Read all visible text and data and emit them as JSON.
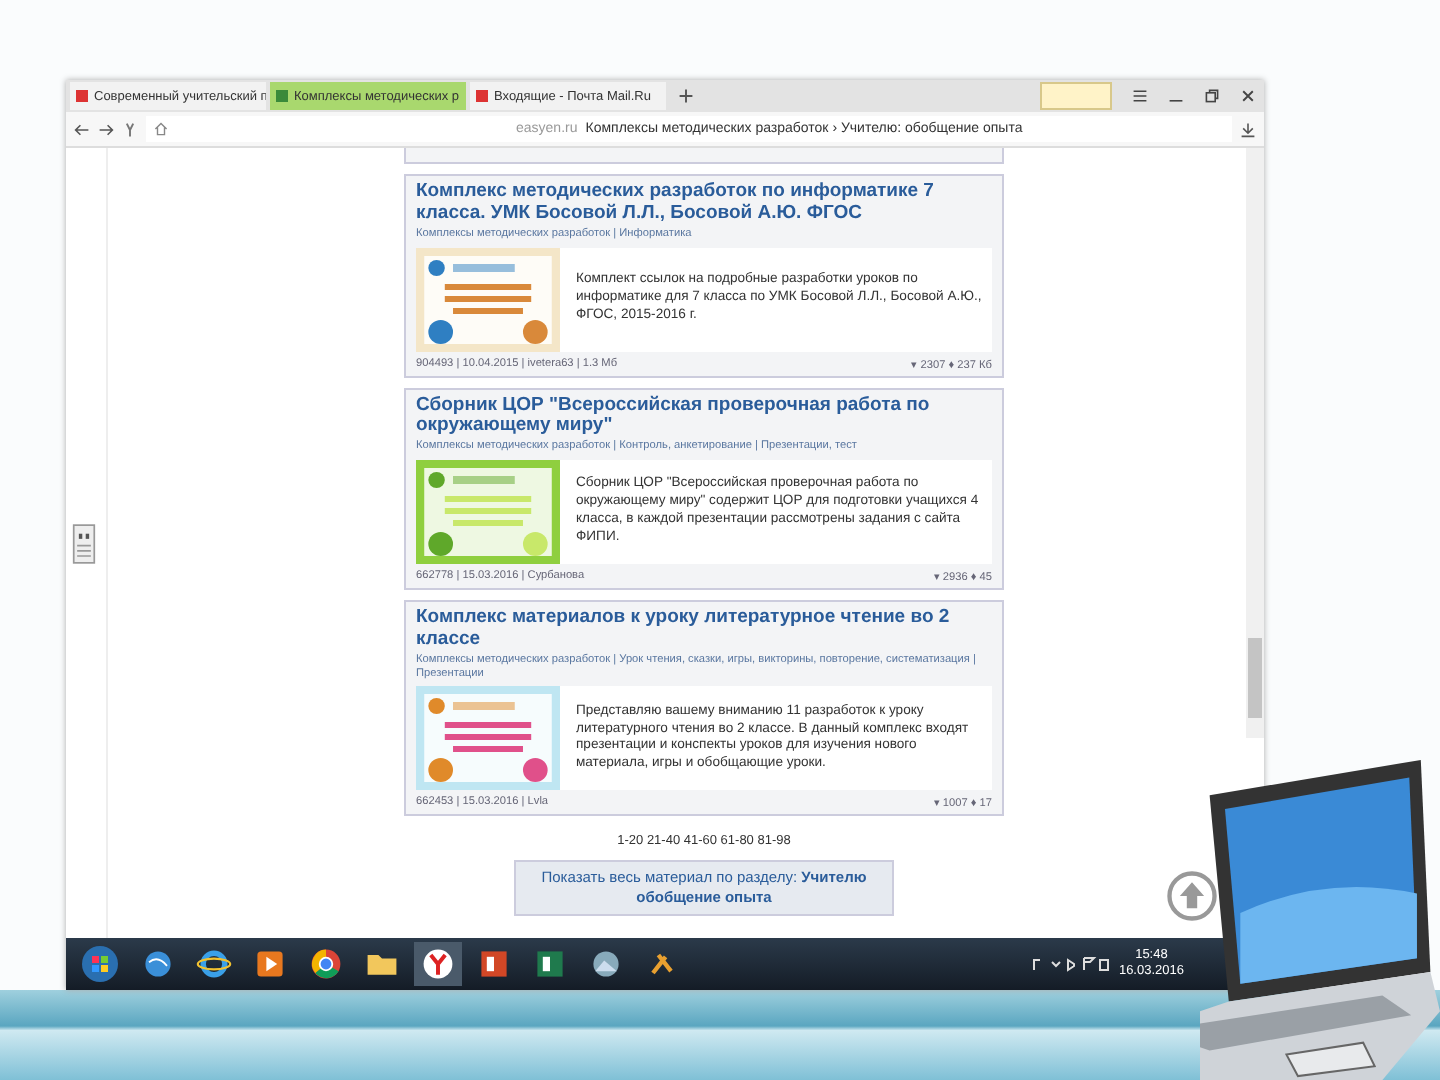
{
  "browser": {
    "tabs": [
      {
        "label": "Современный учительский п",
        "selected": false
      },
      {
        "label": "Комплексы методических р",
        "selected": true
      },
      {
        "label": "Входящие - Почта Mail.Ru",
        "selected": false
      }
    ],
    "address": {
      "domain": "easyen.ru",
      "path": "Комплексы методических разработок › Учителю: обобщение опыта"
    }
  },
  "materials": [
    {
      "title": "Комплекс методических разработок по информатике 7 класса. УМК Босовой Л.Л., Босовой А.Ю. ФГОС",
      "category": "Комплексы методических разработок | Информатика",
      "description": "Комплект ссылок на подробные разработки уроков по информатике для 7 класса по УМК Босовой Л.Л., Босовой А.Ю., ФГОС, 2015-2016 г.",
      "meta": "904493 | 10.04.2015 | ivetera63 | 1.3 Мб",
      "stats": "▾ 2307 ♦ 237 Кб"
    },
    {
      "title": "Сборник ЦОР \"Всероссийская проверочная работа по окружающему миру\"",
      "category": "Комплексы методических разработок | Контроль, анкетирование | Презентации, тест",
      "description": "Сборник ЦОР \"Всероссийская проверочная работа по окружающему миру\" содержит ЦОР для подготовки учащихся 4 класса, в каждой презентации рассмотрены задания с сайта ФИПИ.",
      "meta": "662778 | 15.03.2016 | Сурбанова",
      "stats": "▾ 2936 ♦ 45"
    },
    {
      "title": "Комплекс материалов к уроку литературное чтение во 2 классе",
      "category": "Комплексы методических разработок | Урок чтения, сказки, игры, викторины, повторение, систематизация | Презентации",
      "description": "Представляю вашему вниманию 11 разработок к уроку литературного чтения во 2 классе. В данный комплекс входят презентации и конспекты уроков для изучения нового материала, игры и обобщающие уроки.",
      "meta": "662453 | 15.03.2016 | Lvla",
      "stats": "▾ 1007 ♦ 17"
    }
  ],
  "pagination": "1-20 21-40 41-60 61-80 81-98",
  "show_all": "Показать весь материал по разделу: **Учителю обобщение опыта**",
  "taskbar": {
    "time": "15:48",
    "date": "16.03.2016"
  }
}
